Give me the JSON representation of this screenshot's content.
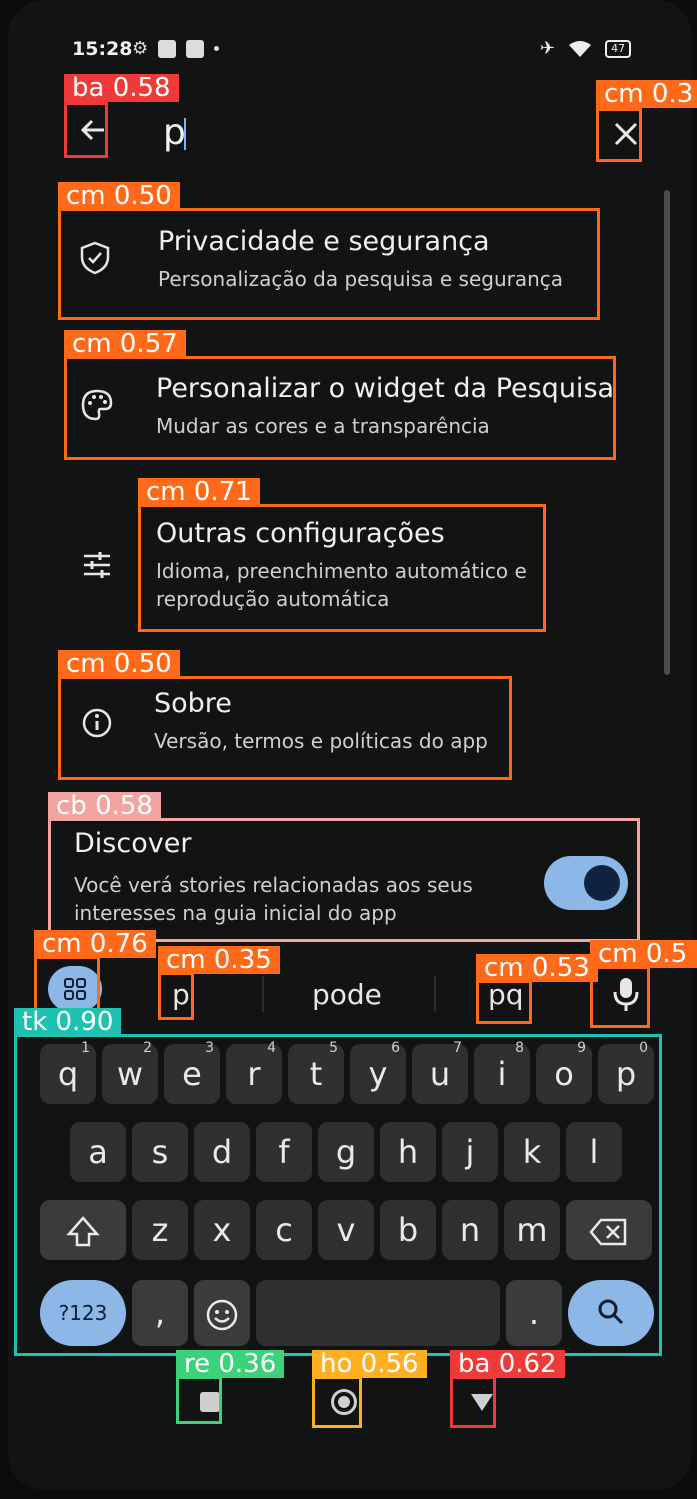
{
  "status_bar": {
    "time": "15:28",
    "battery": "47"
  },
  "search": {
    "query": "p"
  },
  "settings_items": [
    {
      "title": "Privacidade e segurança",
      "subtitle": "Personalização da pesquisa e segurança",
      "icon": "shield-check-icon"
    },
    {
      "title": "Personalizar o widget da Pesquisa",
      "subtitle": "Mudar as cores e a transparência",
      "icon": "palette-icon"
    },
    {
      "title": "Outras configurações",
      "subtitle_line1": "Idioma, preenchimento automático e",
      "subtitle_line2": "reprodução automática",
      "icon": "tune-sliders-icon"
    },
    {
      "title": "Sobre",
      "subtitle": "Versão, termos e políticas do app",
      "icon": "info-icon"
    }
  ],
  "discover": {
    "title": "Discover",
    "subtitle_line1": "Você verá stories relacionadas aos seus",
    "subtitle_line2": "interesses na guia inicial do app",
    "enabled": true
  },
  "suggestions": [
    "p",
    "pode",
    "pq"
  ],
  "keyboard": {
    "row1": [
      {
        "key": "q",
        "num": "1"
      },
      {
        "key": "w",
        "num": "2"
      },
      {
        "key": "e",
        "num": "3"
      },
      {
        "key": "r",
        "num": "4"
      },
      {
        "key": "t",
        "num": "5"
      },
      {
        "key": "y",
        "num": "6"
      },
      {
        "key": "u",
        "num": "7"
      },
      {
        "key": "i",
        "num": "8"
      },
      {
        "key": "o",
        "num": "9"
      },
      {
        "key": "p",
        "num": "0"
      }
    ],
    "row2": [
      "a",
      "s",
      "d",
      "f",
      "g",
      "h",
      "j",
      "k",
      "l"
    ],
    "row3": [
      "z",
      "x",
      "c",
      "v",
      "b",
      "n",
      "m"
    ],
    "symbols_label": "?123",
    "comma": ",",
    "period": "."
  },
  "annotations": [
    {
      "label": "ba 0.58"
    },
    {
      "label": "cm 0.3"
    },
    {
      "label": "cm 0.50"
    },
    {
      "label": "cm 0.57"
    },
    {
      "label": "cm 0.71"
    },
    {
      "label": "cm 0.50"
    },
    {
      "label": "cb 0.58"
    },
    {
      "label": "cm 0.76"
    },
    {
      "label": "cm 0.35"
    },
    {
      "label": "cm 0.53"
    },
    {
      "label": "cm 0.5"
    },
    {
      "label": "tk 0.90"
    },
    {
      "label": "re 0.36"
    },
    {
      "label": "ho 0.56"
    },
    {
      "label": "ba 0.62"
    }
  ],
  "colors": {
    "accent": "#8db7e6",
    "annotation_orange": "#ff6a1a",
    "annotation_red": "#ef3a3a",
    "annotation_teal": "#1fc2b1"
  }
}
